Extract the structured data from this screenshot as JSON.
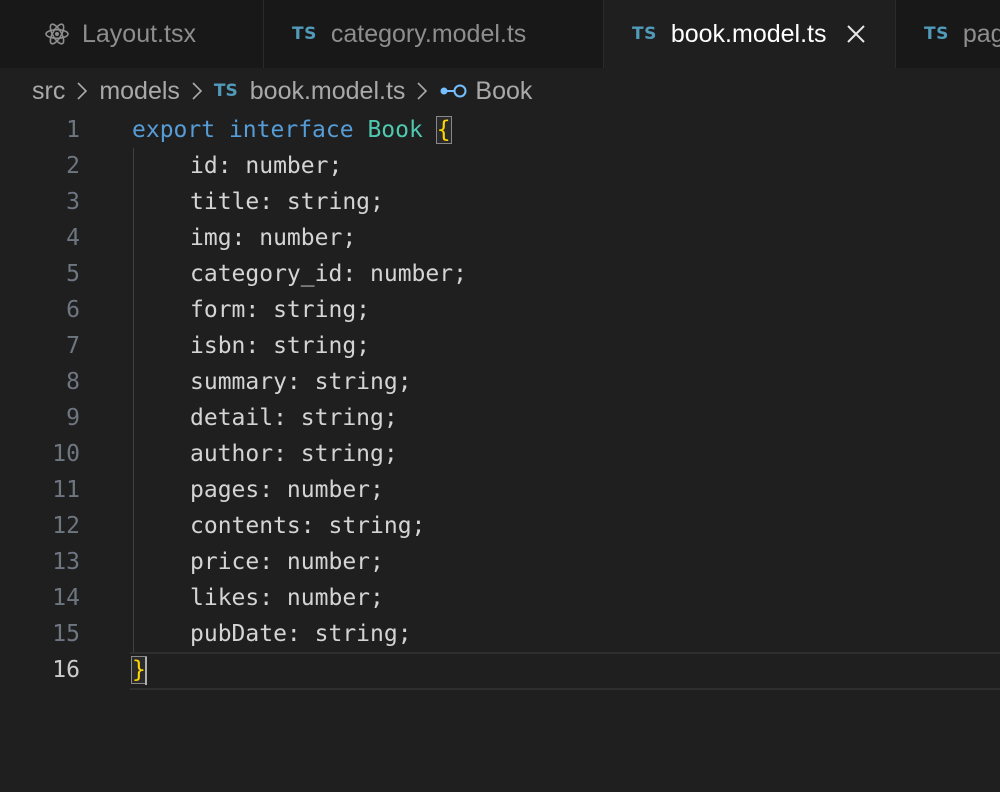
{
  "tabs": [
    {
      "label": "Layout.tsx",
      "icon": "react-icon"
    },
    {
      "label": "category.model.ts",
      "badge": "TS"
    },
    {
      "label": "book.model.ts",
      "badge": "TS",
      "active": true
    },
    {
      "label": "pag",
      "badge": "TS"
    }
  ],
  "breadcrumb": {
    "items": [
      "src",
      "models",
      "book.model.ts",
      "Book"
    ],
    "file_badge": "TS"
  },
  "code": {
    "keyword_export": "export",
    "keyword_interface": "interface",
    "type_name": "Book",
    "open_brace": "{",
    "close_brace": "}",
    "fields": [
      "id: number;",
      "title: string;",
      "img: number;",
      "category_id: number;",
      "form: string;",
      "isbn: string;",
      "summary: string;",
      "detail: string;",
      "author: string;",
      "pages: number;",
      "contents: string;",
      "price: number;",
      "likes: number;",
      "pubDate: string;"
    ],
    "line_numbers": [
      "1",
      "2",
      "3",
      "4",
      "5",
      "6",
      "7",
      "8",
      "9",
      "10",
      "11",
      "12",
      "13",
      "14",
      "15",
      "16"
    ]
  },
  "colors": {
    "keyword": "#569cd6",
    "type": "#4ec9b0",
    "brace": "#ffd700",
    "ts_badge": "#519aba"
  }
}
